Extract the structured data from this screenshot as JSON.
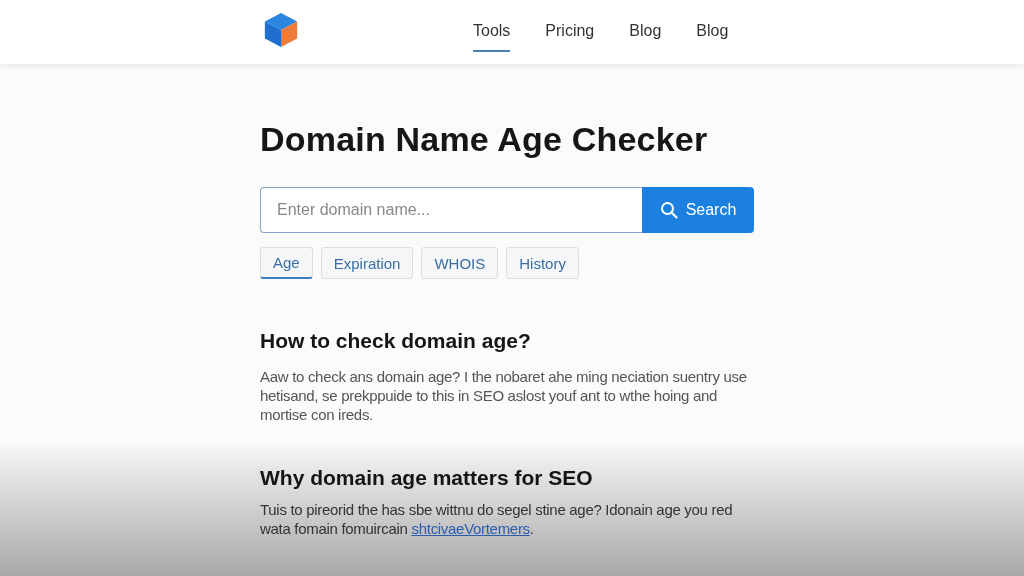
{
  "nav": {
    "items": [
      {
        "label": "Tools",
        "selected": true
      },
      {
        "label": "Pricing",
        "selected": false
      },
      {
        "label": "Blog",
        "selected": false
      },
      {
        "label": "Blog",
        "selected": false
      }
    ]
  },
  "title": "Domain Name Age Checker",
  "search": {
    "placeholder": "Enter domain name...",
    "button": "Search"
  },
  "tabs": [
    {
      "label": "Age",
      "selected": true
    },
    {
      "label": "Expiration",
      "selected": false
    },
    {
      "label": "WHOIS",
      "selected": false
    },
    {
      "label": "History",
      "selected": false
    }
  ],
  "sections": [
    {
      "heading": "How to check domain age?",
      "text": "Aaw to check ans domain age? I the nobaret ahe ming neciation suentry use hetisand, se prekppuide to this in SEO aslost youf ant to wthe hoing and mortise con ireds."
    },
    {
      "heading": "Why domain age matters for SEO",
      "text": "Tuis to pireorid the has sbe wittnu do segel stine age? Idonain age you red wata fomain fomuircain ",
      "link": "shtcivaeVortemers",
      "after": "."
    }
  ]
}
